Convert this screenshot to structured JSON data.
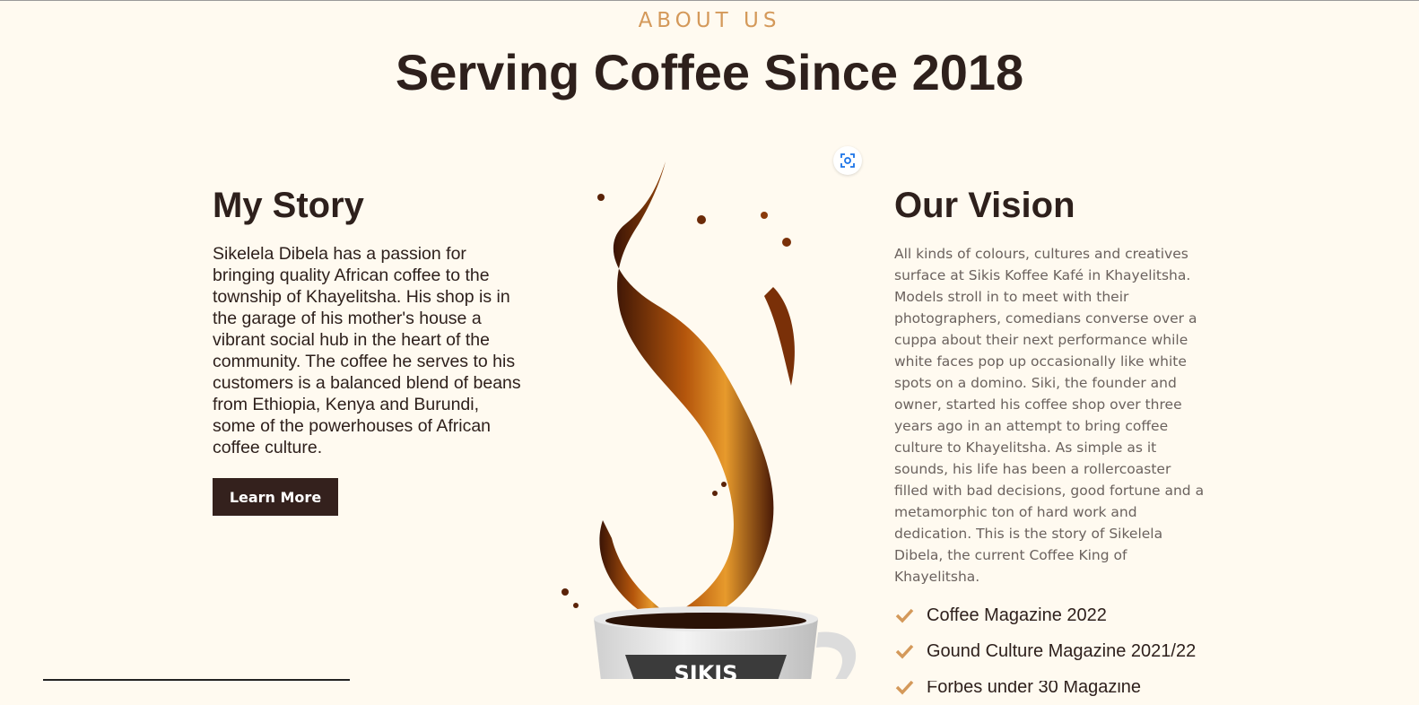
{
  "section": {
    "eyebrow": "ABOUT US",
    "headline": "Serving Coffee Since 2018"
  },
  "story": {
    "title": "My Story",
    "body": "Sikelela Dibela has a passion for bringing quality African coffee to the township of Khayelitsha. His shop is in the garage of his mother's house a vibrant social hub in the heart of the community. The coffee he serves to his customers is a balanced blend of beans from Ethiopia, Kenya and Burundi, some of the powerhouses of African coffee culture.",
    "button_label": "Learn More"
  },
  "vision": {
    "title": "Our Vision",
    "body": "All kinds of colours, cultures and creatives surface at Sikis Koffee Kafé in Khayelitsha. Models stroll in to meet with their photographers, comedians converse over a cuppa about their next performance while white faces pop up occasionally like white spots on a domino. Siki, the founder and owner, started his coffee shop over three years ago in an attempt to bring coffee culture to Khayelitsha. As simple as it sounds, his life has been a rollercoaster filled with bad decisions, good fortune and a metamorphic ton of hard work and dedication. This is the story of Sikelela Dibela, the current Coffee King of Khayelitsha.",
    "awards": [
      {
        "label": "Coffee Magazine 2022"
      },
      {
        "label": "Gound Culture Magazine 2021/22"
      },
      {
        "label": "Forbes under 30 Magazine"
      }
    ]
  },
  "image": {
    "cup_text": "SIKIS",
    "lens_icon": "visual-search-icon"
  },
  "colors": {
    "background": "#fffaf0",
    "accent": "#d4995a",
    "dark": "#2e201c",
    "button": "#34211d",
    "muted_text": "#6b625e"
  }
}
